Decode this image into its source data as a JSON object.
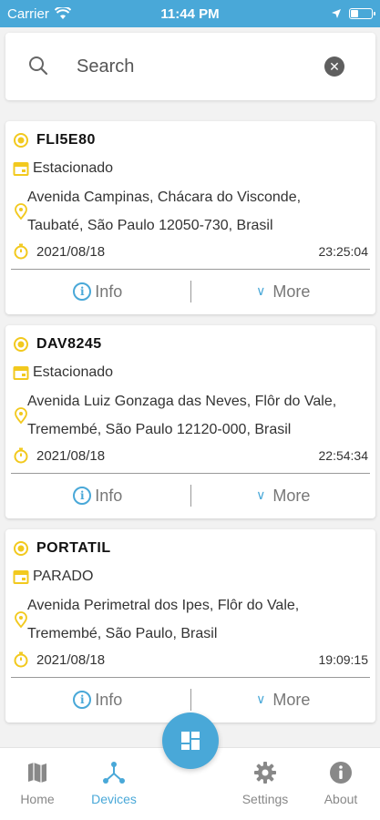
{
  "status_bar": {
    "carrier": "Carrier",
    "time": "11:44 PM"
  },
  "search": {
    "placeholder": "Search"
  },
  "colors": {
    "accent": "#49a8d8",
    "icon_yellow": "#f2c91e"
  },
  "vehicles": [
    {
      "plate": "FLI5E80",
      "status": "Estacionado",
      "address_line1": "Avenida Campinas, Chácara do Visconde,",
      "address_line2": "Taubaté, São Paulo 12050-730, Brasil",
      "date": "2021/08/18",
      "time": "23:25:04",
      "info_label": "Info",
      "more_label": "More"
    },
    {
      "plate": "DAV8245",
      "status": "Estacionado",
      "address_line1": "Avenida Luiz Gonzaga das Neves, Flôr do Vale,",
      "address_line2": "Tremembé, São Paulo 12120-000, Brasil",
      "date": "2021/08/18",
      "time": "22:54:34",
      "info_label": "Info",
      "more_label": "More"
    },
    {
      "plate": "PORTATIL",
      "status": "PARADO",
      "address_line1": "Avenida Perimetral dos Ipes, Flôr do Vale,",
      "address_line2": "Tremembé, São Paulo, Brasil",
      "date": "2021/08/18",
      "time": "19:09:15",
      "info_label": "Info",
      "more_label": "More"
    }
  ],
  "bottom_nav": {
    "home": "Home",
    "devices": "Devices",
    "settings": "Settings",
    "about": "About",
    "active": "devices"
  }
}
